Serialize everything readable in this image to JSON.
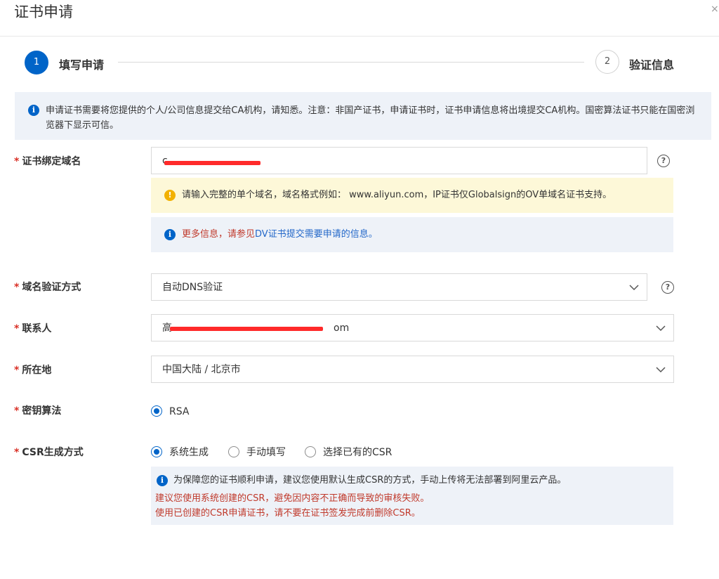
{
  "dialog": {
    "title": "证书申请",
    "close_icon": "×"
  },
  "steps": [
    {
      "number": "1",
      "label": "填写申请",
      "state": "active"
    },
    {
      "number": "2",
      "label": "验证信息",
      "state": "pending"
    }
  ],
  "notice": {
    "icon": "info-icon",
    "text": "申请证书需要将您提供的个人/公司信息提交给CA机构，请知悉。注意：非国产证书，申请证书时，证书申请信息将出境提交CA机构。国密算法证书只能在国密浏览器下显示可信。"
  },
  "form": {
    "required_mark": "*",
    "domain": {
      "label": "证书绑定域名",
      "value": "c",
      "warning": "请输入完整的单个域名，域名格式例如： www.aliyun.com，IP证书仅Globalsign的OV单域名证书支持。",
      "info_prefix": "更多信息，请参见",
      "info_link": "DV证书提交需要申请的信息。"
    },
    "validation": {
      "label": "域名验证方式",
      "value": "自动DNS验证"
    },
    "contact": {
      "label": "联系人",
      "value_prefix": "高",
      "value_suffix": "om"
    },
    "location": {
      "label": "所在地",
      "value": "中国大陆 / 北京市"
    },
    "algorithm": {
      "label": "密钥算法",
      "options": [
        "RSA"
      ],
      "selected": "RSA"
    },
    "csr": {
      "label": "CSR生成方式",
      "options": [
        "系统生成",
        "手动填写",
        "选择已有的CSR"
      ],
      "selected": "系统生成",
      "tip_main": "为保障您的证书顺利申请，建议您使用默认生成CSR的方式，手动上传将无法部署到阿里云产品。",
      "tip_warn1": "建议您使用系统创建的CSR，避免因内容不正确而导致的审核失败。",
      "tip_warn2": "使用已创建的CSR申请证书，请不要在证书签发完成前删除CSR。"
    }
  },
  "colors": {
    "primary": "#0064c8",
    "required": "#d93026",
    "warning_bg": "#fdf8d8",
    "info_bg": "#eef2f8",
    "redaction": "#ff2a2a"
  }
}
